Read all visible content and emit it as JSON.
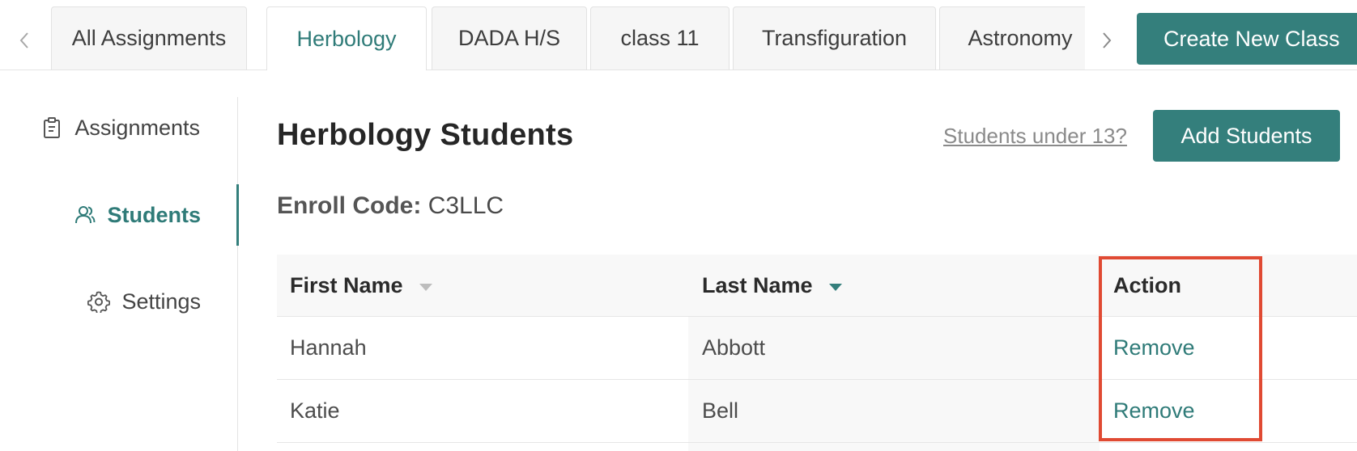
{
  "tabs": [
    {
      "label": "All Assignments",
      "active": false
    },
    {
      "label": "Herbology",
      "active": true
    },
    {
      "label": "DADA H/S",
      "active": false
    },
    {
      "label": "class 11",
      "active": false
    },
    {
      "label": "Transfiguration",
      "active": false
    },
    {
      "label": "Astronomy",
      "active": false
    }
  ],
  "create_class_label": "Create New Class",
  "sidebar": {
    "items": [
      {
        "label": "Assignments",
        "icon": "clipboard-icon"
      },
      {
        "label": "Students",
        "icon": "users-icon",
        "active": true
      },
      {
        "label": "Settings",
        "icon": "gear-icon"
      }
    ]
  },
  "main": {
    "title": "Herbology Students",
    "under13_link": "Students under 13?",
    "add_students_label": "Add Students",
    "enroll_label": "Enroll Code:",
    "enroll_code": "C3LLC"
  },
  "table": {
    "columns": [
      "First Name",
      "Last Name",
      "Action"
    ],
    "sorted_column": "Last Name",
    "rows": [
      {
        "first": "Hannah",
        "last": "Abbott",
        "action": "Remove"
      },
      {
        "first": "Katie",
        "last": "Bell",
        "action": "Remove"
      }
    ]
  },
  "colors": {
    "accent": "#347f7c",
    "highlight": "#e04a33"
  }
}
